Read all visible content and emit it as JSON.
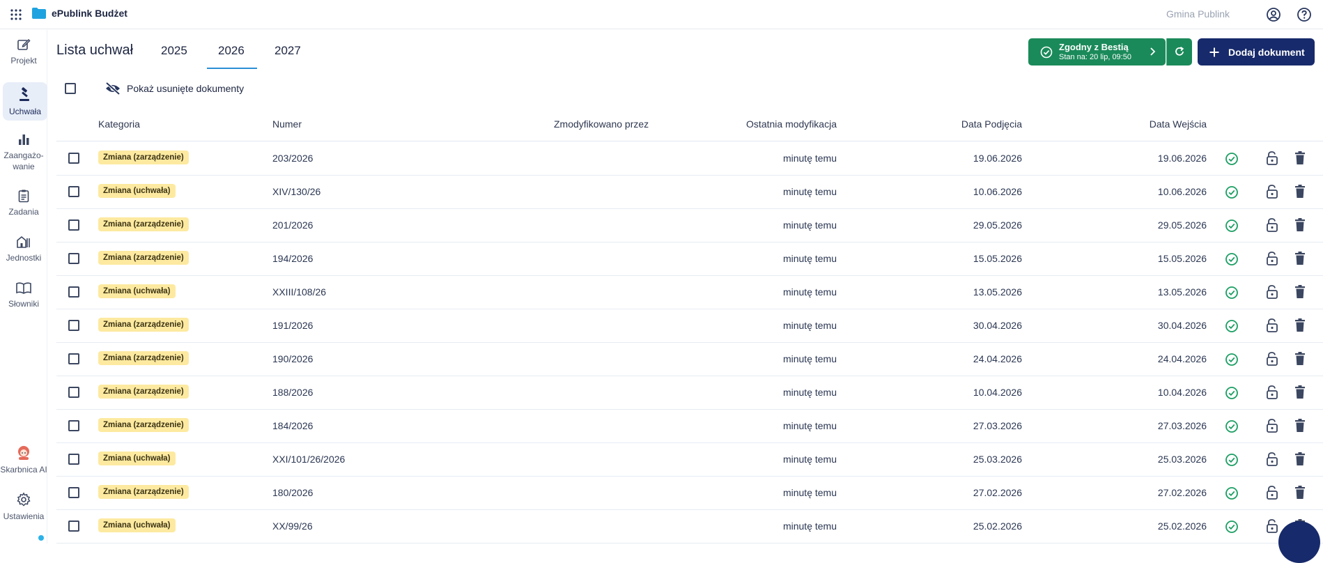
{
  "topbar": {
    "app_name": "ePublink Budżet",
    "organization": "Gmina Publink"
  },
  "sidebar": {
    "items": [
      {
        "label": "Projekt",
        "icon": "edit-icon"
      },
      {
        "label": "Uchwała",
        "icon": "gavel-icon",
        "active": true
      },
      {
        "label": "Zaangażo-",
        "label2": "wanie",
        "icon": "bar-chart-icon"
      },
      {
        "label": "Zadania",
        "icon": "clipboard-icon"
      },
      {
        "label": "Jednostki",
        "icon": "building-icon"
      },
      {
        "label": "Słowniki",
        "icon": "book-icon"
      },
      {
        "label": "Skarbnica AI",
        "icon": "ai-avatar-icon"
      },
      {
        "label": "Ustawienia",
        "icon": "gear-icon"
      }
    ]
  },
  "page": {
    "title": "Lista uchwał",
    "tabs": [
      "2025",
      "2026",
      "2027"
    ],
    "active_tab": "2026"
  },
  "status": {
    "main": "Zgodny z Bestią",
    "sub": "Stan na: 20 lip, 09:50",
    "color": "#1b8a5a"
  },
  "actions": {
    "add_label": "Dodaj dokument",
    "show_deleted_label": "Pokaż usunięte dokumenty"
  },
  "table": {
    "columns": [
      "Kategoria",
      "Numer",
      "Zmodyfikowano przez",
      "Ostatnia modyfikacja",
      "Data Podjęcia",
      "Data Wejścia"
    ],
    "rows": [
      {
        "category": "Zmiana (zarządzenie)",
        "number": "203/2026",
        "modified_by": "",
        "last_mod": "minutę temu",
        "date_adopted": "19.06.2026",
        "date_effective": "19.06.2026"
      },
      {
        "category": "Zmiana (uchwała)",
        "number": "XIV/130/26",
        "modified_by": "",
        "last_mod": "minutę temu",
        "date_adopted": "10.06.2026",
        "date_effective": "10.06.2026"
      },
      {
        "category": "Zmiana (zarządzenie)",
        "number": "201/2026",
        "modified_by": "",
        "last_mod": "minutę temu",
        "date_adopted": "29.05.2026",
        "date_effective": "29.05.2026"
      },
      {
        "category": "Zmiana (zarządzenie)",
        "number": "194/2026",
        "modified_by": "",
        "last_mod": "minutę temu",
        "date_adopted": "15.05.2026",
        "date_effective": "15.05.2026"
      },
      {
        "category": "Zmiana (uchwała)",
        "number": "XXIII/108/26",
        "modified_by": "",
        "last_mod": "minutę temu",
        "date_adopted": "13.05.2026",
        "date_effective": "13.05.2026"
      },
      {
        "category": "Zmiana (zarządzenie)",
        "number": "191/2026",
        "modified_by": "",
        "last_mod": "minutę temu",
        "date_adopted": "30.04.2026",
        "date_effective": "30.04.2026"
      },
      {
        "category": "Zmiana (zarządzenie)",
        "number": "190/2026",
        "modified_by": "",
        "last_mod": "minutę temu",
        "date_adopted": "24.04.2026",
        "date_effective": "24.04.2026"
      },
      {
        "category": "Zmiana (zarządzenie)",
        "number": "188/2026",
        "modified_by": "",
        "last_mod": "minutę temu",
        "date_adopted": "10.04.2026",
        "date_effective": "10.04.2026"
      },
      {
        "category": "Zmiana (zarządzenie)",
        "number": "184/2026",
        "modified_by": "",
        "last_mod": "minutę temu",
        "date_adopted": "27.03.2026",
        "date_effective": "27.03.2026"
      },
      {
        "category": "Zmiana (uchwała)",
        "number": "XXI/101/26/2026",
        "modified_by": "",
        "last_mod": "minutę temu",
        "date_adopted": "25.03.2026",
        "date_effective": "25.03.2026"
      },
      {
        "category": "Zmiana (zarządzenie)",
        "number": "180/2026",
        "modified_by": "",
        "last_mod": "minutę temu",
        "date_adopted": "27.02.2026",
        "date_effective": "27.02.2026"
      },
      {
        "category": "Zmiana (uchwała)",
        "number": "XX/99/26",
        "modified_by": "",
        "last_mod": "minutę temu",
        "date_adopted": "25.02.2026",
        "date_effective": "25.02.2026"
      }
    ]
  },
  "colors": {
    "accent": "#172a6b",
    "tab_underline": "#2b8fd6",
    "badge_bg": "#fdeaa0",
    "success": "#1b8a5a"
  }
}
